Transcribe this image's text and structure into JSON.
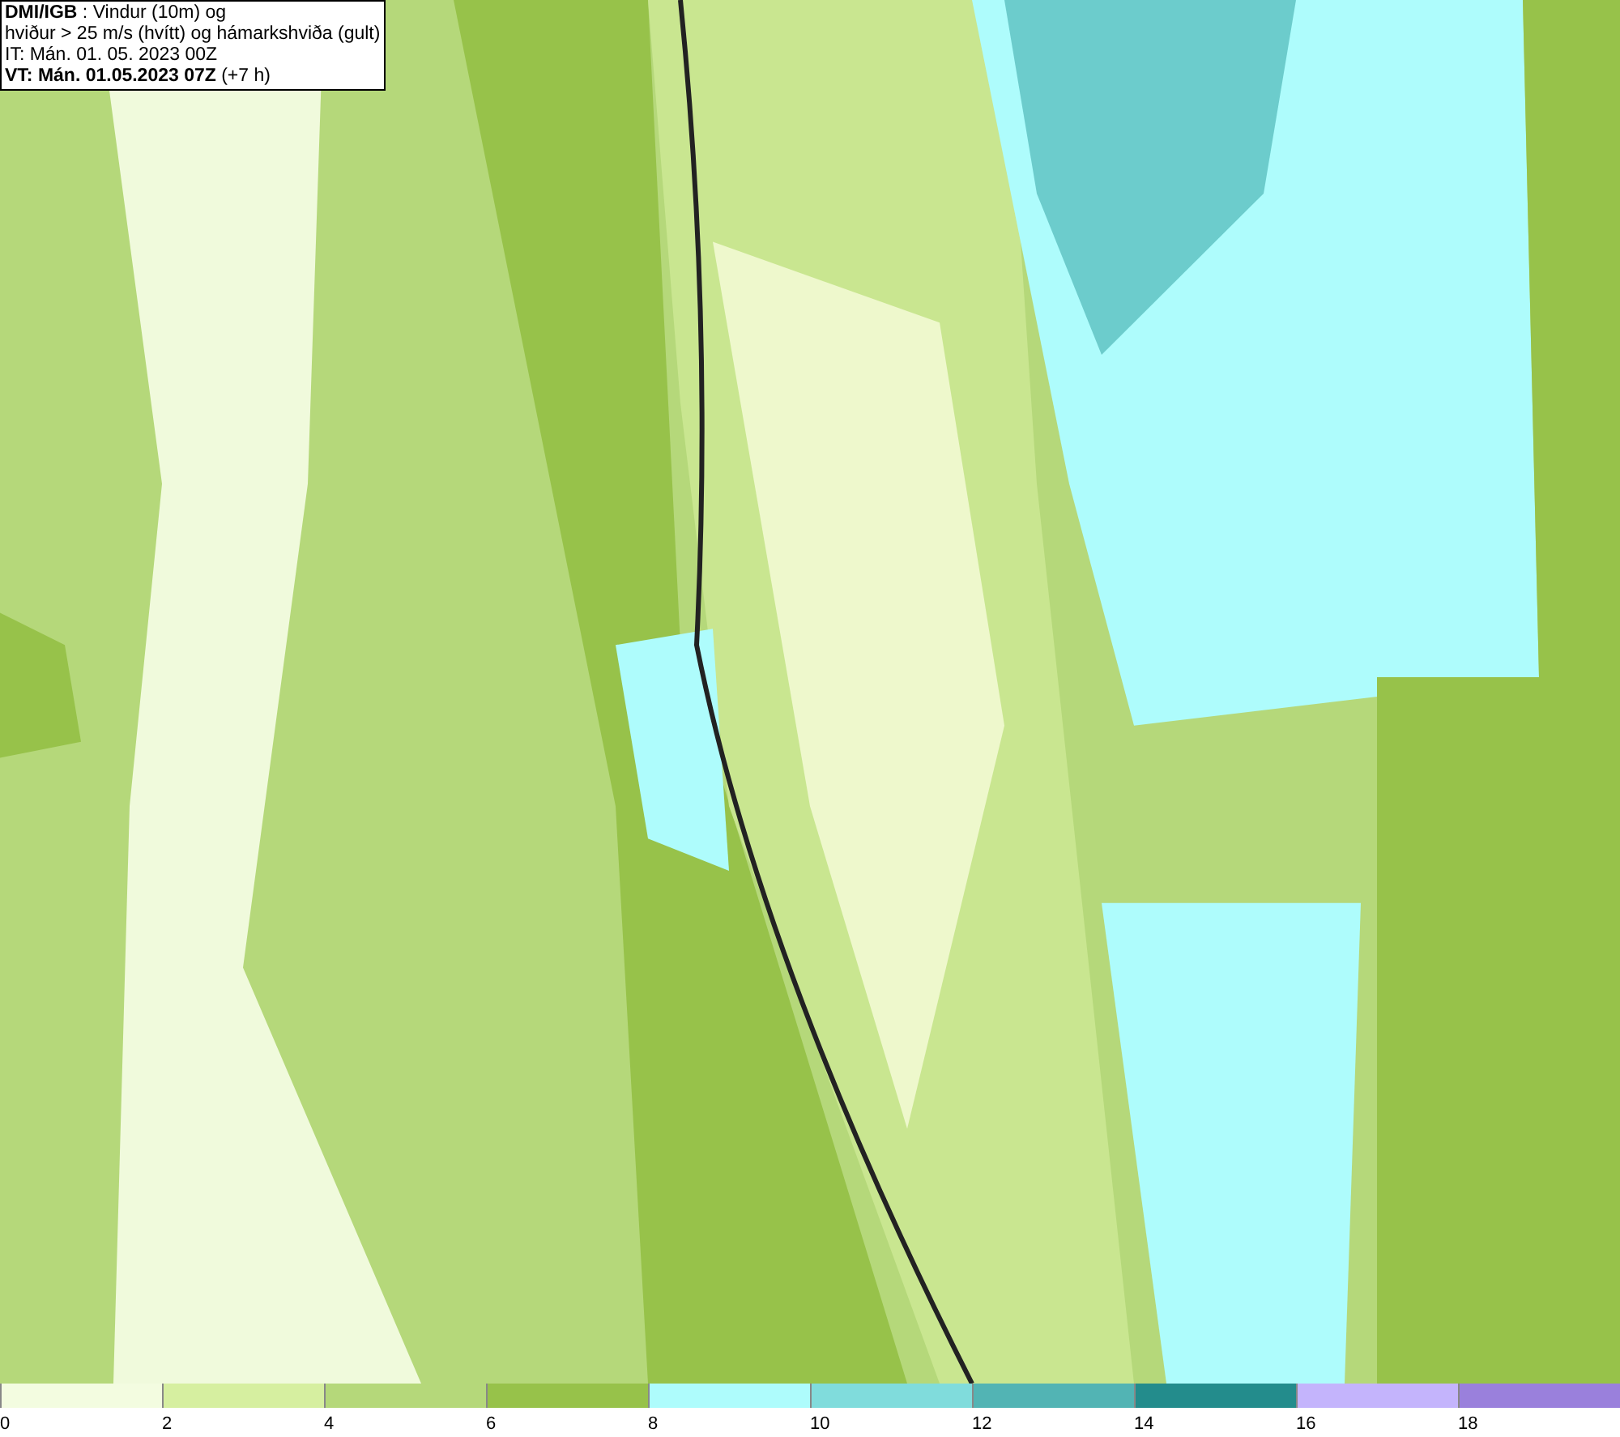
{
  "header": {
    "lines": [
      "**DMI/IGB** : Vindur (10m) og",
      "hviður > 25 m/s (hvítt) og hámarkshviða (gult)",
      "IT: Mán. 01. 05. 2023 00Z",
      "**VT: Mán. 01.05.2023 07Z** (+7 h)"
    ]
  },
  "legend": {
    "bins": [
      {
        "color": "#f3fce0",
        "label": "0"
      },
      {
        "color": "#d6efa0",
        "label": "2"
      },
      {
        "color": "#b5d87a",
        "label": "4"
      },
      {
        "color": "#97c24a",
        "label": "6"
      },
      {
        "color": "#aefcfc",
        "label": "8"
      },
      {
        "color": "#80dcdc",
        "label": "10"
      },
      {
        "color": "#52b4b4",
        "label": "12"
      },
      {
        "color": "#238c8c",
        "label": "14"
      },
      {
        "color": "#c4b4fc",
        "label": "16"
      },
      {
        "color": "#9a80dc",
        "label": "18"
      }
    ]
  }
}
